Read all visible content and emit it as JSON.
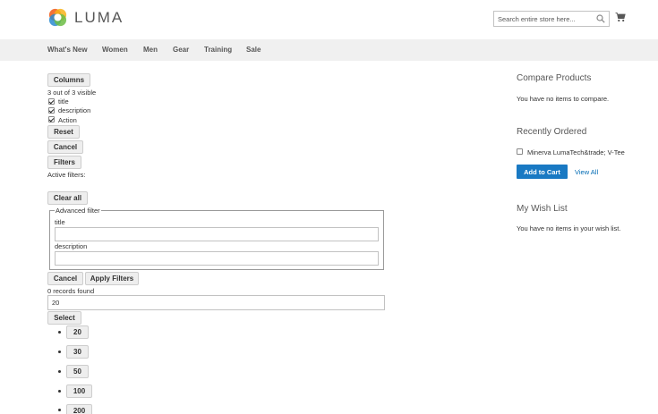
{
  "brand": {
    "name": "LUMA"
  },
  "search": {
    "placeholder": "Search entire store here..."
  },
  "nav": {
    "items": [
      "What's New",
      "Women",
      "Men",
      "Gear",
      "Training",
      "Sale"
    ]
  },
  "grid": {
    "columns_button": "Columns",
    "visible_text": "3 out of 3 visible",
    "columns": [
      {
        "label": "title",
        "checked": true
      },
      {
        "label": "description",
        "checked": true
      },
      {
        "label": "Action",
        "checked": true
      }
    ],
    "reset_button": "Reset",
    "cancel_button": "Cancel",
    "filters_button": "Filters",
    "active_filters_label": "Active filters:",
    "clear_all_button": "Clear all",
    "advanced_filter": {
      "legend": "Advanced filter",
      "title_label": "title",
      "description_label": "description",
      "title_value": "",
      "description_value": ""
    },
    "filter_cancel_button": "Cancel",
    "apply_filters_button": "Apply Filters",
    "records_found": "0 records found",
    "page_size_value": "20",
    "select_button": "Select",
    "page_size_options": [
      "20",
      "30",
      "50",
      "100",
      "200"
    ]
  },
  "sidebar": {
    "compare": {
      "title": "Compare Products",
      "empty_text": "You have no items to compare."
    },
    "recently_ordered": {
      "title": "Recently Ordered",
      "item_label": "Minerva LumaTech&trade; V-Tee",
      "item_checked": false,
      "add_to_cart": "Add to Cart",
      "view_all": "View All"
    },
    "wishlist": {
      "title": "My Wish List",
      "empty_text": "You have no items in your wish list."
    }
  },
  "colors": {
    "accent": "#1979c3",
    "nav_bg": "#f0f0f0",
    "link": "#006bb4"
  }
}
